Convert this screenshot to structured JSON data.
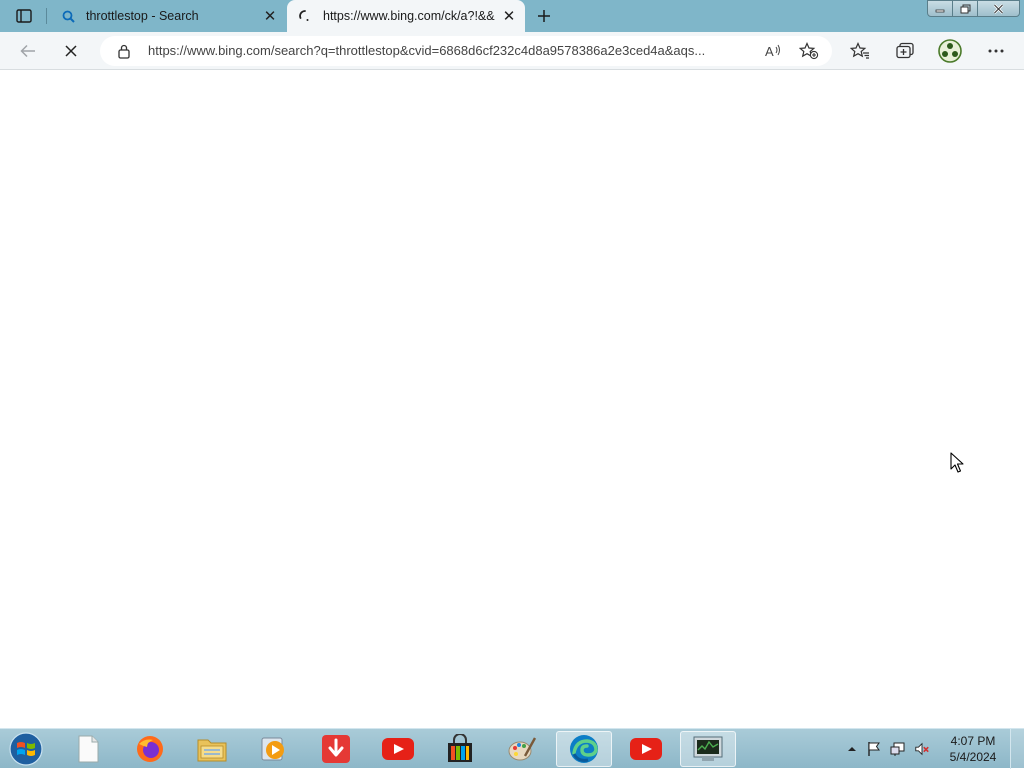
{
  "browser": {
    "tabs": [
      {
        "title": "throttlestop - Search",
        "icon": "bing-search-icon",
        "active": false
      },
      {
        "title": "https://www.bing.com/ck/a?!&&",
        "icon": "loading-spinner-icon",
        "active": true
      }
    ],
    "address_url": "https://www.bing.com/search?q=throttlestop&cvid=6868d6cf232c4d8a9578386a2e3ced4a&aqs...",
    "read_aloud_label": "A⁠⁾",
    "loading": true
  },
  "taskbar": {
    "apps": [
      "document-icon",
      "firefox-icon",
      "file-explorer-icon",
      "media-player-icon",
      "download-manager-icon",
      "youtube-icon",
      "store-bag-icon",
      "paint-icon",
      "edge-icon",
      "youtube-icon",
      "task-manager-icon"
    ],
    "clock": {
      "time": "4:07 PM",
      "date": "5/4/2024"
    }
  },
  "colors": {
    "tabstrip": "#7fb6c9",
    "toolbar": "#f3f6f8",
    "taskbar": "#8db7c8",
    "youtube_red": "#e62117",
    "edge_blue": "#0c7ec6"
  }
}
